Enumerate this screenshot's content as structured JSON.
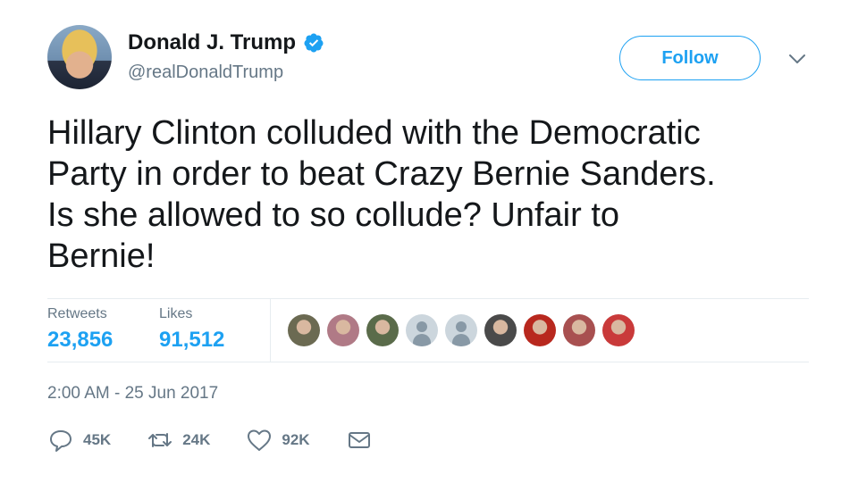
{
  "author": {
    "name": "Donald J. Trump",
    "handle": "@realDonaldTrump",
    "verified": true
  },
  "follow_button": {
    "label": "Follow"
  },
  "tweet": {
    "text": "Hillary Clinton colluded with the Democratic\nParty in order to beat Crazy Bernie Sanders.\nIs she allowed to so collude? Unfair to\nBernie!",
    "timestamp": "2:00 AM - 25 Jun 2017"
  },
  "stats": {
    "retweets_label": "Retweets",
    "retweets_value": "23,856",
    "likes_label": "Likes",
    "likes_value": "91,512"
  },
  "likers": [
    {
      "color": "#6b6a52"
    },
    {
      "color": "#b07a86"
    },
    {
      "color": "#5a6b4a"
    },
    {
      "color": "default"
    },
    {
      "color": "default"
    },
    {
      "color": "#4a4a4a"
    },
    {
      "color": "#b8281e"
    },
    {
      "color": "#a85050"
    },
    {
      "color": "#c93a3a"
    }
  ],
  "actions": {
    "reply_count": "45K",
    "retweet_count": "24K",
    "like_count": "92K"
  },
  "colors": {
    "accent": "#1da1f2",
    "secondary_text": "#657786",
    "primary_text": "#14171a"
  }
}
